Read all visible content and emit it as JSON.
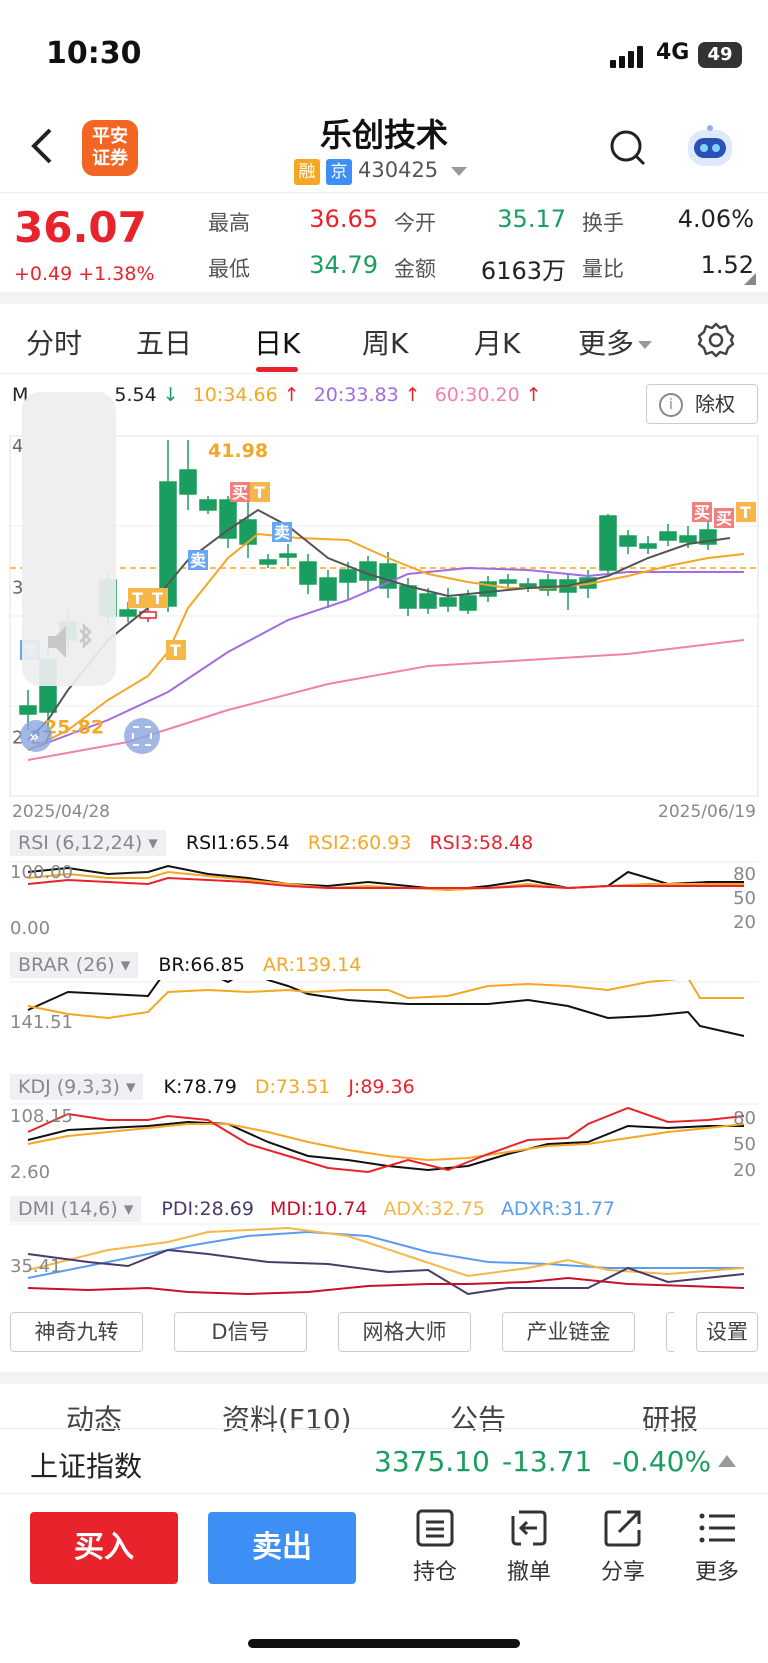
{
  "status_bar": {
    "time": "10:30",
    "network": "4G",
    "battery": "49"
  },
  "header": {
    "back_icon": "chevron-left-icon",
    "logo_text": "平安证券",
    "title": "乐创技术",
    "tags": [
      {
        "label": "融",
        "color": "#f5a623"
      },
      {
        "label": "京",
        "color": "#3d8ef5"
      }
    ],
    "code": "430425"
  },
  "quote": {
    "price": "36.07",
    "change": "+0.49 +1.38%",
    "fields": [
      {
        "label": "最高",
        "value": "36.65",
        "color": "#e8232b"
      },
      {
        "label": "今开",
        "value": "35.17",
        "color": "#1a9e5f"
      },
      {
        "label": "换手",
        "value": "4.06%",
        "color": "#222"
      },
      {
        "label": "最低",
        "value": "34.79",
        "color": "#1a9e5f"
      },
      {
        "label": "金额",
        "value": "6163万",
        "color": "#222"
      },
      {
        "label": "量比",
        "value": "1.52",
        "color": "#222"
      }
    ]
  },
  "period_tabs": [
    "分时",
    "五日",
    "日K",
    "周K",
    "月K",
    "更多"
  ],
  "active_tab": "日K",
  "ma_legend": {
    "ma5_prefix": "M",
    "ma5_value": "5.54",
    "ma10": "10:34.66",
    "ma20": "20:33.83",
    "ma60": "60:30.20",
    "chuquan": "除权"
  },
  "kline_axis": {
    "top_label": "4",
    "mid_label": "3",
    "bottom_label": "2",
    "high_mark": "41.98",
    "low_mark": "25.82",
    "low_prefix": "27",
    "start_date": "2025/04/28",
    "end_date": "2025/06/19"
  },
  "rsi": {
    "name": "RSI (6,12,24)",
    "v1": "RSI1:65.54",
    "v2": "RSI2:60.93",
    "v3": "RSI3:58.48",
    "ytop": "100.00",
    "ybot": "0.00",
    "r1": "80",
    "r2": "50",
    "r3": "20"
  },
  "brar": {
    "name": "BRAR (26)",
    "br": "BR:66.85",
    "ar": "AR:139.14",
    "ylab": "141.51"
  },
  "kdj": {
    "name": "KDJ (9,3,3)",
    "k": "K:78.79",
    "d": "D:73.51",
    "j": "J:89.36",
    "ytop": "108.15",
    "ybot": "2.60",
    "r1": "80",
    "r2": "50",
    "r3": "20"
  },
  "dmi": {
    "name": "DMI (14,6)",
    "pdi": "PDI:28.69",
    "mdi": "MDI:10.74",
    "adx": "ADX:32.75",
    "adxr": "ADXR:31.77",
    "ylab": "35.41"
  },
  "tools": [
    "神奇九转",
    "D信号",
    "网格大师",
    "产业链金",
    "设置"
  ],
  "news_tabs": [
    "动态",
    "资料(F10)",
    "公告",
    "研报"
  ],
  "index_bar": {
    "name": "上证指数",
    "value": "3375.10",
    "change": "-13.71",
    "pct": "-0.40%"
  },
  "bottom_bar": {
    "buy": "买入",
    "sell": "卖出",
    "actions": [
      "持仓",
      "撤单",
      "分享",
      "更多"
    ]
  },
  "colors": {
    "up": "#e8232b",
    "down": "#1a9e5f",
    "accent": "#3d8ef5",
    "ma10": "#f5a623",
    "ma20": "#a36be0",
    "ma60": "#f080b0"
  }
}
